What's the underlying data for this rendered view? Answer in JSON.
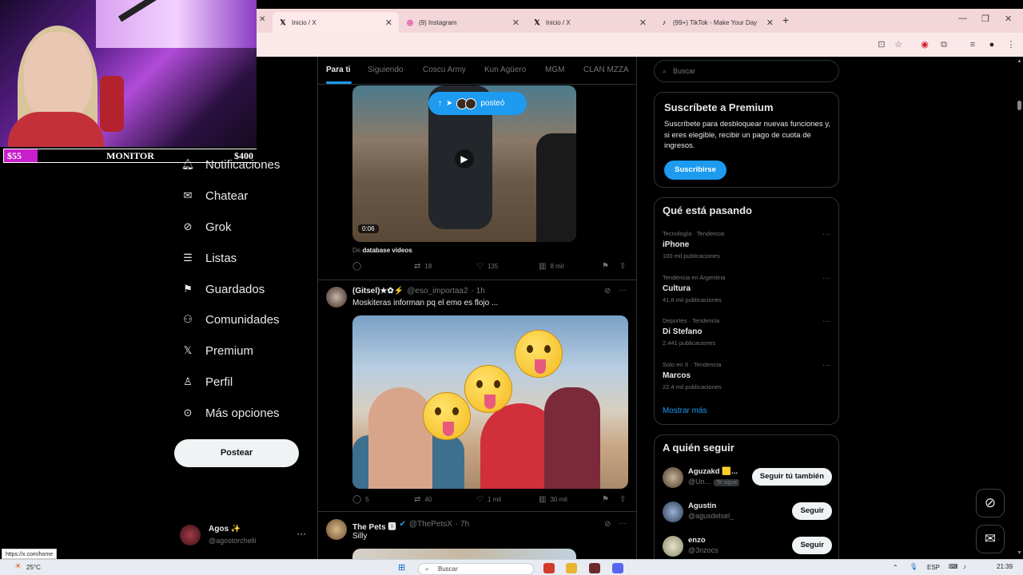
{
  "overlay": {
    "left_amount": "$55",
    "title": "MONITOR",
    "right_amount": "$400"
  },
  "browser": {
    "tabs": [
      {
        "label": "Inicio / X",
        "icon": "x-logo-icon",
        "active": true
      },
      {
        "label": "(9) Instagram",
        "icon": "instagram-icon",
        "active": false
      },
      {
        "label": "Inicio / X",
        "icon": "x-logo-icon",
        "active": false
      },
      {
        "label": "(99+) TikTok - Make Your Day",
        "icon": "tiktok-icon",
        "active": false
      }
    ],
    "new_tab": "+",
    "status_url": "https://x.com/home"
  },
  "nav": {
    "items": [
      {
        "label": "Notificaciones",
        "icon": "bell-icon"
      },
      {
        "label": "Chatear",
        "icon": "mail-icon"
      },
      {
        "label": "Grok",
        "icon": "grok-icon"
      },
      {
        "label": "Listas",
        "icon": "list-icon"
      },
      {
        "label": "Guardados",
        "icon": "bookmark-icon"
      },
      {
        "label": "Comunidades",
        "icon": "people-icon"
      },
      {
        "label": "Premium",
        "icon": "x-logo-icon"
      },
      {
        "label": "Perfil",
        "icon": "person-icon"
      },
      {
        "label": "Más opciones",
        "icon": "more-circle-icon"
      }
    ],
    "post_button": "Postear",
    "account": {
      "name": "Agos ✨",
      "handle": "@agostorchelli"
    }
  },
  "feed": {
    "tabs": [
      "Para ti",
      "Siguiendo",
      "Coscu Army",
      "Kun Agüero",
      "MGM",
      "CLAN MZZA"
    ],
    "posted_pill": "posteó",
    "tweet1": {
      "duration": "0:06",
      "source_prefix": "De",
      "source": "database videos",
      "replies": "",
      "reposts": "18",
      "likes": "135",
      "views": "8 mil"
    },
    "tweet2": {
      "name": "(Gitsel)★✿⚡",
      "handle": "@eso_importaa2",
      "time": "· 1h",
      "text": "Moskiteras informan pq el emo es flojo ...",
      "replies": "5",
      "reposts": "40",
      "likes": "1 mil",
      "views": "30 mil"
    },
    "tweet3": {
      "name": "The Pets 🆇",
      "handle": "@ThePetsX",
      "time": "· 7h",
      "text": "Silly"
    }
  },
  "sidebar": {
    "search_placeholder": "Buscar",
    "premium": {
      "title": "Suscríbete a Premium",
      "description": "Suscríbete para desbloquear nuevas funciones y, si eres elegible, recibir un pago de cuota de ingresos.",
      "button": "Suscribirse"
    },
    "trends": {
      "title": "Qué está pasando",
      "items": [
        {
          "category": "Tecnología · Tendencia",
          "name": "iPhone",
          "count": "100 mil publicaciones"
        },
        {
          "category": "Tendencia en Argentina",
          "name": "Cultura",
          "count": "41,6 mil publicaciones"
        },
        {
          "category": "Deportes · Tendencia",
          "name": "Di Stefano",
          "count": "2.441 publicaciones"
        },
        {
          "category": "Solo en X · Tendencia",
          "name": "Marcos",
          "count": "22,4 mil publicaciones"
        }
      ],
      "show_more": "Mostrar más"
    },
    "who_to_follow": {
      "title": "A quién seguir",
      "items": [
        {
          "name": "Aguzakd 🟨...",
          "handle": "@Un...",
          "badge": "Te sigue",
          "button": "Seguir tú también"
        },
        {
          "name": "Agustin",
          "handle": "@agusdelsel_",
          "badge": "",
          "button": "Seguir"
        },
        {
          "name": "enzo",
          "handle": "@3nzocs",
          "badge": "",
          "button": "Seguir"
        }
      ]
    }
  },
  "taskbar": {
    "weather": "25°C",
    "search": "Buscar",
    "lang": "ESP",
    "time": "21:39"
  }
}
